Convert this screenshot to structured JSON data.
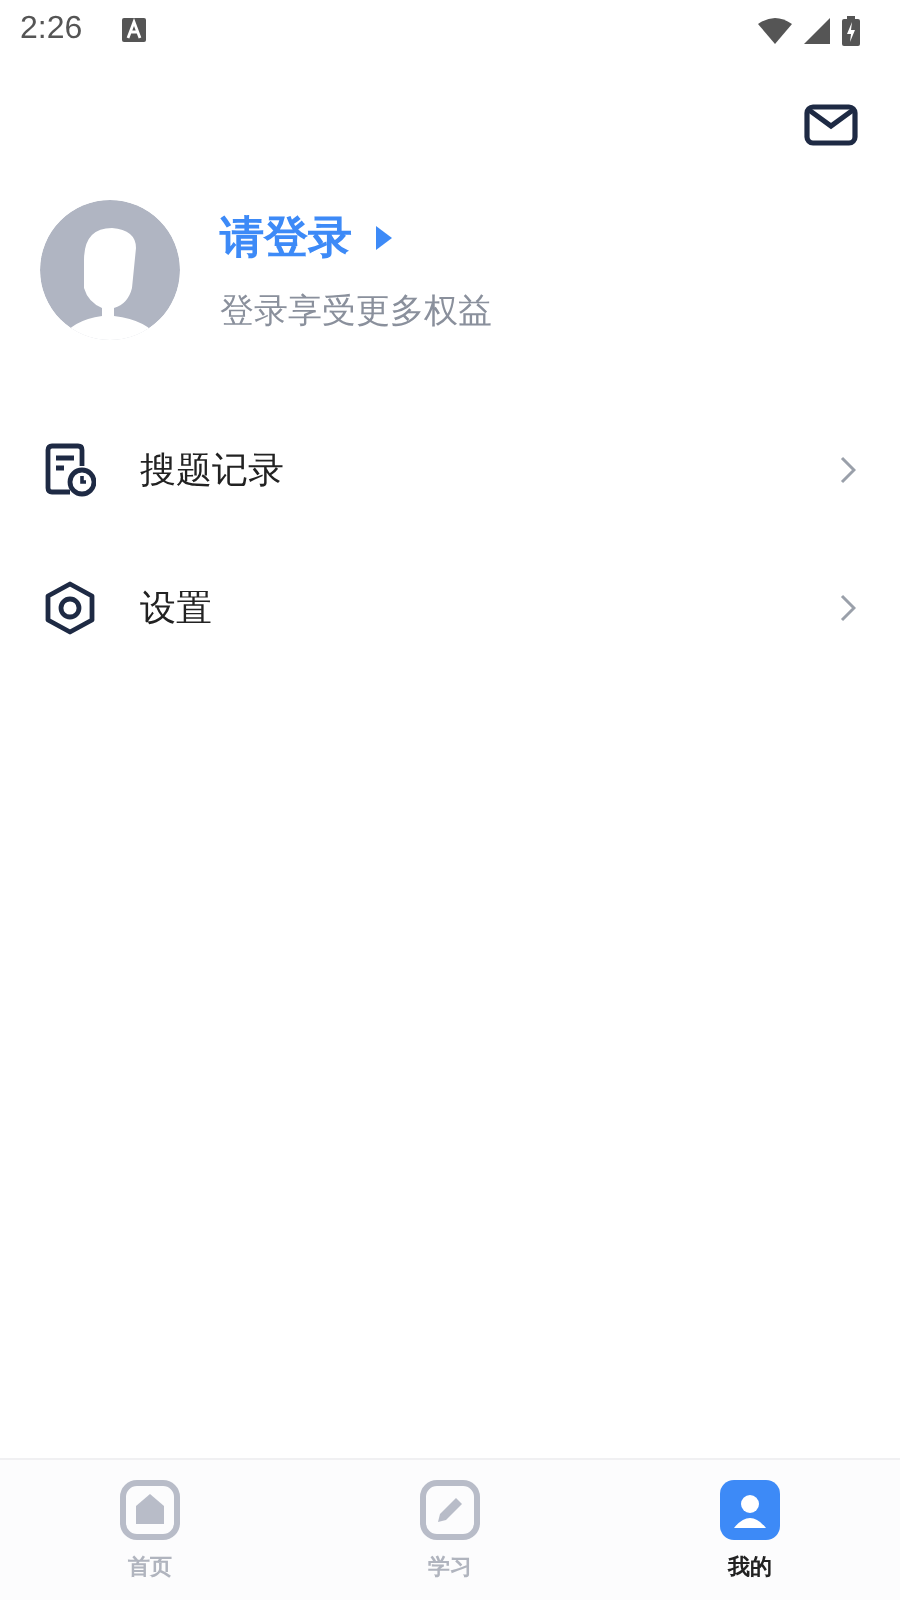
{
  "status_bar": {
    "time": "2:26"
  },
  "profile": {
    "title": "请登录",
    "subtitle": "登录享受更多权益"
  },
  "menu": [
    {
      "kind": "history",
      "label": "搜题记录"
    },
    {
      "kind": "settings",
      "label": "设置"
    }
  ],
  "tabs": [
    {
      "kind": "home",
      "label": "首页",
      "selected": false
    },
    {
      "kind": "study",
      "label": "学习",
      "selected": false
    },
    {
      "kind": "mine",
      "label": "我的",
      "selected": true
    }
  ]
}
